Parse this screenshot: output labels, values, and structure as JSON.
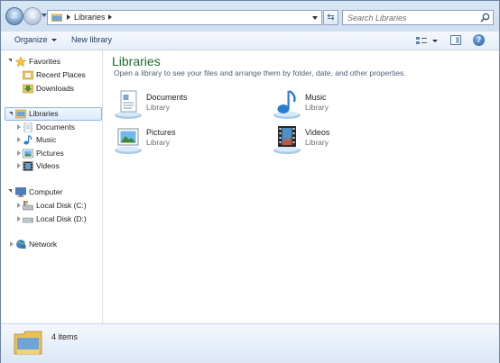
{
  "address": {
    "crumbs": [
      "Libraries"
    ],
    "search_placeholder": "Search Libraries"
  },
  "commands": {
    "organize": "Organize",
    "new_library": "New library"
  },
  "nav": {
    "favorites": {
      "label": "Favorites",
      "items": [
        "Recent Places",
        "Downloads"
      ]
    },
    "libraries": {
      "label": "Libraries",
      "items": [
        "Documents",
        "Music",
        "Pictures",
        "Videos"
      ]
    },
    "computer": {
      "label": "Computer",
      "items": [
        "Local Disk (C:)",
        "Local Disk (D:)"
      ]
    },
    "network": {
      "label": "Network"
    }
  },
  "main": {
    "title": "Libraries",
    "subtitle": "Open a library to see your files and arrange them by folder, date, and other properties.",
    "libraries": [
      {
        "name": "Documents",
        "type": "Library",
        "icon": "documents-library-icon"
      },
      {
        "name": "Music",
        "type": "Library",
        "icon": "music-library-icon"
      },
      {
        "name": "Pictures",
        "type": "Library",
        "icon": "pictures-library-icon"
      },
      {
        "name": "Videos",
        "type": "Library",
        "icon": "videos-library-icon"
      }
    ]
  },
  "details": {
    "count": "4 items"
  },
  "colors": {
    "title_green": "#1e6b2f",
    "selection": "#dbeafb"
  }
}
